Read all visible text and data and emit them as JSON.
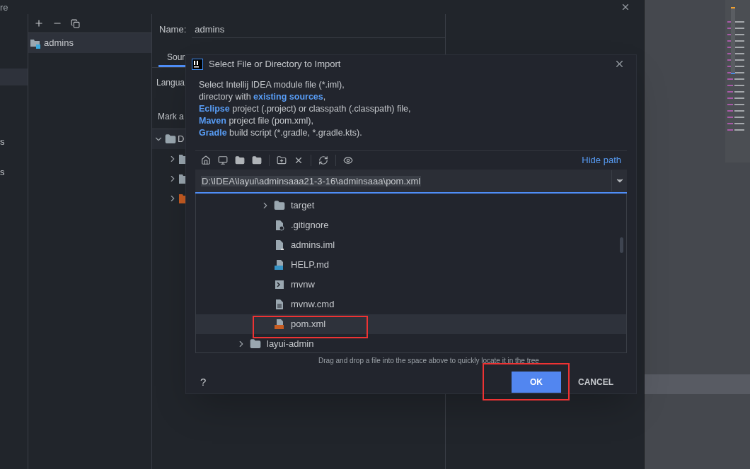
{
  "background_window": {
    "title_fragment": "re",
    "sidebar_rows": [
      {
        "selected": true
      },
      {
        "label": "s",
        "selected": false
      },
      {
        "label": "s",
        "selected": false
      }
    ],
    "modules": [
      {
        "name": "admins",
        "selected": true
      }
    ],
    "module_settings": {
      "name_label": "Name:",
      "name_value": "admins",
      "tab": {
        "label": "Sour",
        "selected": true
      },
      "language_label": "Langua",
      "mark_label": "Mark a",
      "tree": [
        {
          "label": "D",
          "kind": "folder",
          "expanded": true,
          "children": [
            {
              "kind": "folder"
            },
            {
              "kind": "folder"
            },
            {
              "kind": "resources"
            }
          ]
        }
      ]
    }
  },
  "dialog": {
    "title": "Select File or Directory to Import",
    "description": [
      "Select Intellij IDEA module file (*.iml),",
      "directory with **existing sources**,",
      "**Eclipse** project (.project) or classpath (.classpath) file,",
      "**Maven** project file (pom.xml),",
      "**Gradle** build script (*.gradle, *.gradle.kts)."
    ],
    "hide_path": "Hide path",
    "path": "D:\\IDEA\\layui\\adminsaaa21-3-16\\adminsaaa\\pom.xml",
    "tree": [
      {
        "children": [
          {
            "label": "target",
            "kind": "folder",
            "expanded": false,
            "selected": false
          },
          {
            "label": ".gitignore",
            "kind": "ignore",
            "selected": false
          },
          {
            "label": "admins.iml",
            "kind": "iml",
            "selected": false
          },
          {
            "label": "HELP.md",
            "kind": "markdown",
            "selected": false
          },
          {
            "label": "mvnw",
            "kind": "script",
            "selected": false
          },
          {
            "label": "mvnw.cmd",
            "kind": "text",
            "selected": false
          },
          {
            "label": "pom.xml",
            "kind": "xml",
            "selected": true,
            "annotated": true
          }
        ]
      },
      {
        "label": "layui-admin",
        "kind": "folder",
        "expanded": false,
        "selected": false
      }
    ],
    "hint": "Drag and drop a file into the space above to quickly locate it in the tree",
    "help": "?",
    "ok": {
      "label": "OK",
      "annotated": true
    },
    "cancel": "CANCEL"
  }
}
